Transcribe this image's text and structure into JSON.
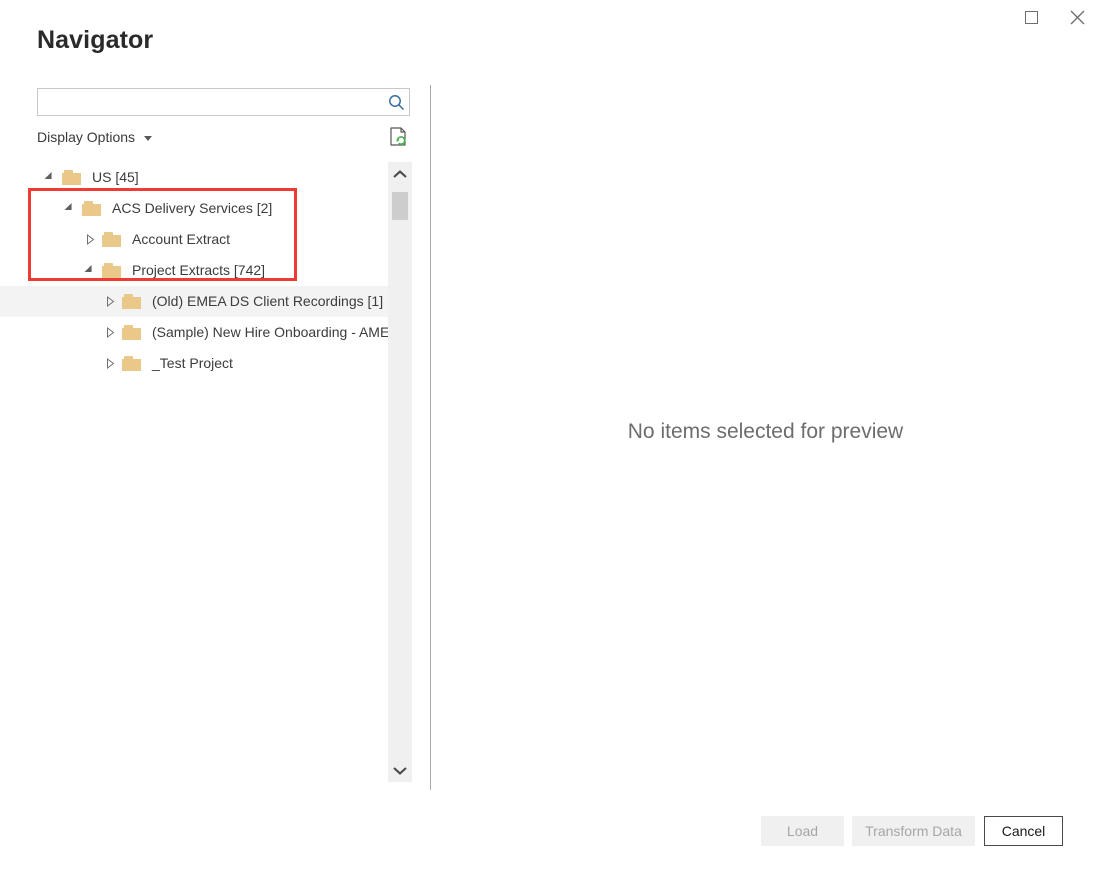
{
  "window": {
    "title": "Navigator",
    "controls": [
      {
        "name": "maximize-button",
        "icon": "maximize-icon",
        "label": ""
      },
      {
        "name": "close-button",
        "icon": "close-icon",
        "label": "✕"
      }
    ]
  },
  "search": {
    "value": "",
    "placeholder": "",
    "icon": "search-icon"
  },
  "toolbar": {
    "display_options_label": "Display Options",
    "display_options_caret": "chevron-down-icon",
    "refresh_icon": "refresh-document-icon"
  },
  "tree": {
    "items": [
      {
        "label": "US [45]",
        "depth": 0,
        "state": "expanded",
        "icon": "folder-icon",
        "highlighted": false
      },
      {
        "label": "ACS Delivery Services [2]",
        "depth": 1,
        "state": "expanded",
        "icon": "folder-icon",
        "highlighted": false
      },
      {
        "label": "Account Extract",
        "depth": 2,
        "state": "collapsed",
        "icon": "folder-icon",
        "highlighted": false
      },
      {
        "label": "Project Extracts [742]",
        "depth": 2,
        "state": "expanded",
        "icon": "folder-icon",
        "highlighted": false
      },
      {
        "label": "(Old) EMEA DS Client Recordings [1]",
        "depth": 3,
        "state": "collapsed",
        "icon": "folder-icon",
        "highlighted": true
      },
      {
        "label": "(Sample) New Hire Onboarding - AMER",
        "depth": 3,
        "state": "collapsed",
        "icon": "folder-icon",
        "highlighted": false
      },
      {
        "label": "_Test Project",
        "depth": 3,
        "state": "collapsed",
        "icon": "folder-icon",
        "highlighted": false
      }
    ],
    "scrollbar": {
      "up_arrow": "chevron-up-icon",
      "down_arrow": "chevron-down-icon"
    }
  },
  "preview": {
    "empty_message": "No items selected for preview"
  },
  "footer": {
    "load_label": "Load",
    "transform_label": "Transform Data",
    "cancel_label": "Cancel"
  },
  "annotation": {
    "color": "#ef3a35"
  },
  "colors": {
    "folder": "#eac88a",
    "accent": "#2e6fa8",
    "refresh_green": "#4caf50",
    "annotation_red": "#ef3a35"
  }
}
